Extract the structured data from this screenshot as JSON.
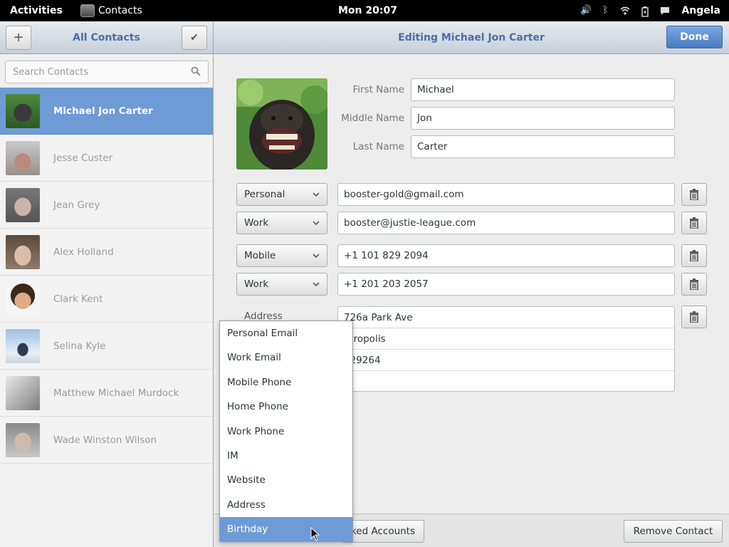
{
  "topbar": {
    "activities": "Activities",
    "app_name": "Contacts",
    "clock": "Mon 20:07",
    "user": "Angela"
  },
  "sidebar": {
    "title": "All Contacts",
    "search_placeholder": "Search Contacts",
    "contacts": [
      {
        "name": "Michael Jon Carter",
        "selected": true
      },
      {
        "name": "Jesse Custer",
        "selected": false
      },
      {
        "name": "Jean Grey",
        "selected": false
      },
      {
        "name": "Alex Holland",
        "selected": false
      },
      {
        "name": "Clark Kent",
        "selected": false
      },
      {
        "name": "Selina Kyle",
        "selected": false
      },
      {
        "name": "Matthew Michael Murdock",
        "selected": false
      },
      {
        "name": "Wade Winston Wilson",
        "selected": false
      }
    ]
  },
  "editor": {
    "title": "Editing Michael Jon Carter",
    "done_label": "Done",
    "first_name_label": "First Name",
    "first_name": "Michael",
    "middle_name_label": "Middle Name",
    "middle_name": "Jon",
    "last_name_label": "Last Name",
    "last_name": "Carter",
    "emails": [
      {
        "type": "Personal",
        "value": "booster-gold@gmail.com"
      },
      {
        "type": "Work",
        "value": "booster@justie-league.com"
      }
    ],
    "phones": [
      {
        "type": "Mobile",
        "value": "+1 101 829 2094"
      },
      {
        "type": "Work",
        "value": "+1 201 203 2057"
      }
    ],
    "address_label": "Address",
    "address_lines": [
      "726a Park Ave",
      "etropolis",
      "829264",
      ""
    ]
  },
  "bottombar": {
    "linked_accounts_label": "ked Accounts",
    "remove_contact_label": "Remove Contact"
  },
  "type_menu": {
    "items": [
      "Personal Email",
      "Work Email",
      "Mobile Phone",
      "Home Phone",
      "Work Phone",
      "IM",
      "Website",
      "Address",
      "Birthday"
    ],
    "highlighted": "Birthday"
  },
  "colors": {
    "accent": "#6e9bd6",
    "title_text": "#4a6fa5",
    "done_button": "#4a7cc4"
  }
}
